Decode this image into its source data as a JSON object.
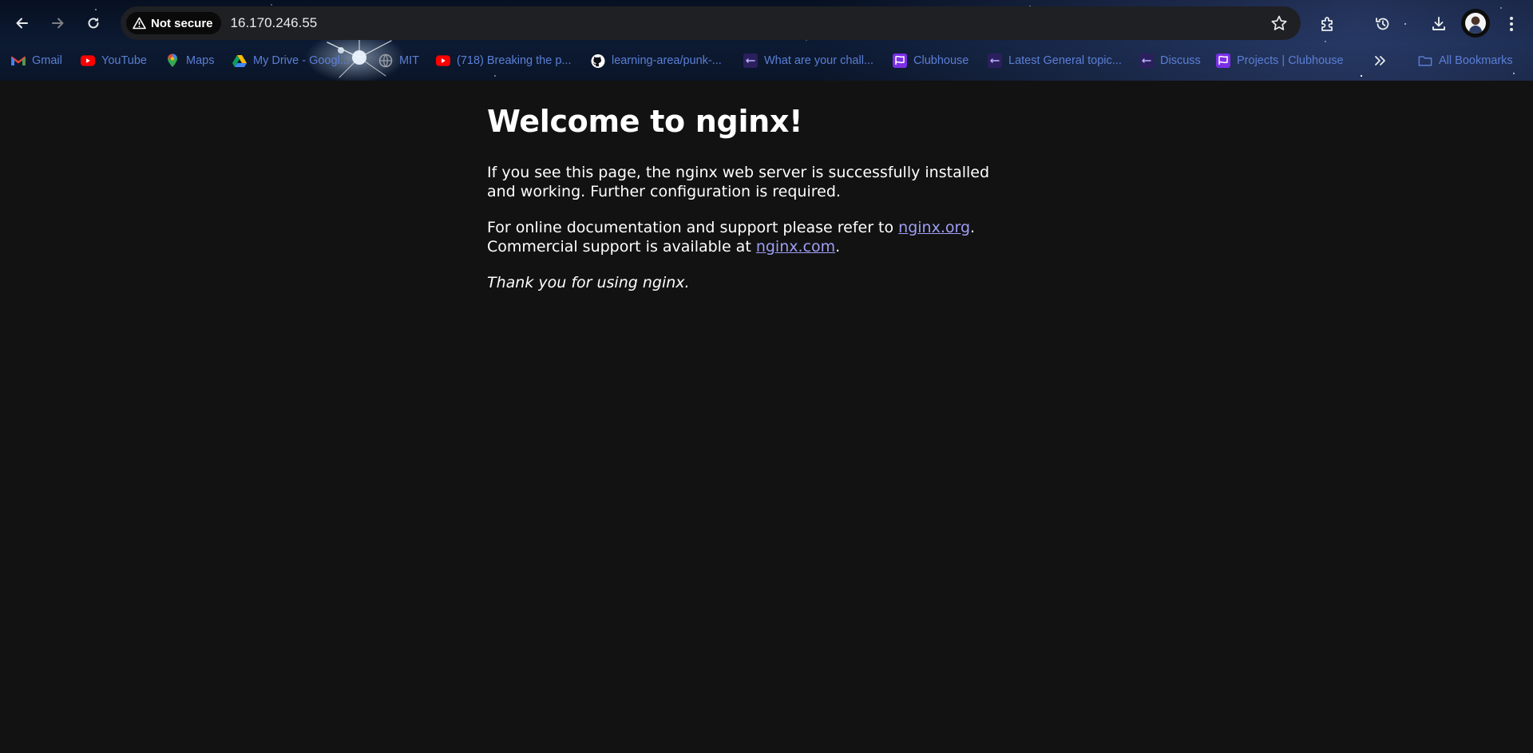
{
  "browser": {
    "security_label": "Not secure",
    "url": "16.170.246.55",
    "bookmarks": [
      {
        "label": "Gmail",
        "icon": "gmail-icon"
      },
      {
        "label": "YouTube",
        "icon": "youtube-icon"
      },
      {
        "label": "Maps",
        "icon": "maps-icon"
      },
      {
        "label": "My Drive - Googl...",
        "icon": "drive-icon"
      },
      {
        "label": "MIT",
        "icon": "globe-icon"
      },
      {
        "label": "(718) Breaking the p...",
        "icon": "youtube-icon"
      },
      {
        "label": "learning-area/punk-...",
        "icon": "github-icon"
      },
      {
        "label": "What are your chall...",
        "icon": "discourse-icon"
      },
      {
        "label": "Clubhouse",
        "icon": "clubhouse-icon"
      },
      {
        "label": "Latest General topic...",
        "icon": "discourse-icon"
      },
      {
        "label": "Discuss",
        "icon": "discourse-icon"
      },
      {
        "label": "Projects | Clubhouse",
        "icon": "clubhouse-icon"
      }
    ],
    "all_bookmarks_label": "All Bookmarks",
    "colors": {
      "chrome_bg": "#0c1a33",
      "omnibox_bg": "#1f2023",
      "bookmark_text": "#5b7fd6"
    }
  },
  "page": {
    "heading": "Welcome to nginx!",
    "para1": "If you see this page, the nginx web server is successfully installed and working. Further configuration is required.",
    "para2_prefix": "For online documentation and support please refer to ",
    "link_org": "nginx.org",
    "para2_mid": ".",
    "para2_line2": "Commercial support is available at ",
    "link_com": "nginx.com",
    "para2_suffix": ".",
    "thanks": "Thank you for using nginx.",
    "colors": {
      "background": "#121212",
      "text": "#ffffff",
      "link": "#9e9ef5"
    }
  }
}
